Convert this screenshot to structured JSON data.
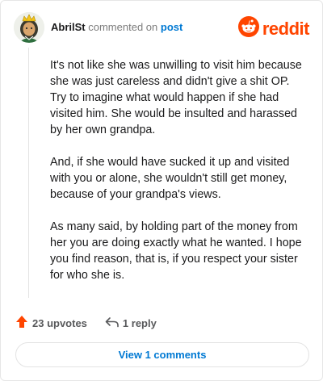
{
  "header": {
    "username": "AbrilSt",
    "action_text": "commented on",
    "post_link": "post",
    "brand": "reddit",
    "avatar_icon": "user-avatar-icon",
    "brand_icon": "reddit-snoo-icon"
  },
  "comment": {
    "paragraphs": [
      "It's not like she was unwilling to visit him because she was just careless and didn't give a shit OP. Try to imagine what would happen if she had visited him. She would be insulted and harassed by her own grandpa.",
      "And, if she would have sucked it up and visited with you or alone, she wouldn't still get money, because of your grandpa's views.",
      "As many said, by holding part of the money from her you are doing exactly what he wanted. I hope you find reason, that is, if you respect your sister for who she is."
    ]
  },
  "footer": {
    "upvotes": "23 upvotes",
    "replies": "1 reply",
    "view_comments": "View 1 comments",
    "upvote_icon": "upvote-arrow-icon",
    "reply_icon": "reply-arrow-icon"
  },
  "colors": {
    "brand": "#ff4500",
    "link": "#0079d3",
    "upvote": "#ff4500",
    "muted": "#7c7c7c"
  }
}
